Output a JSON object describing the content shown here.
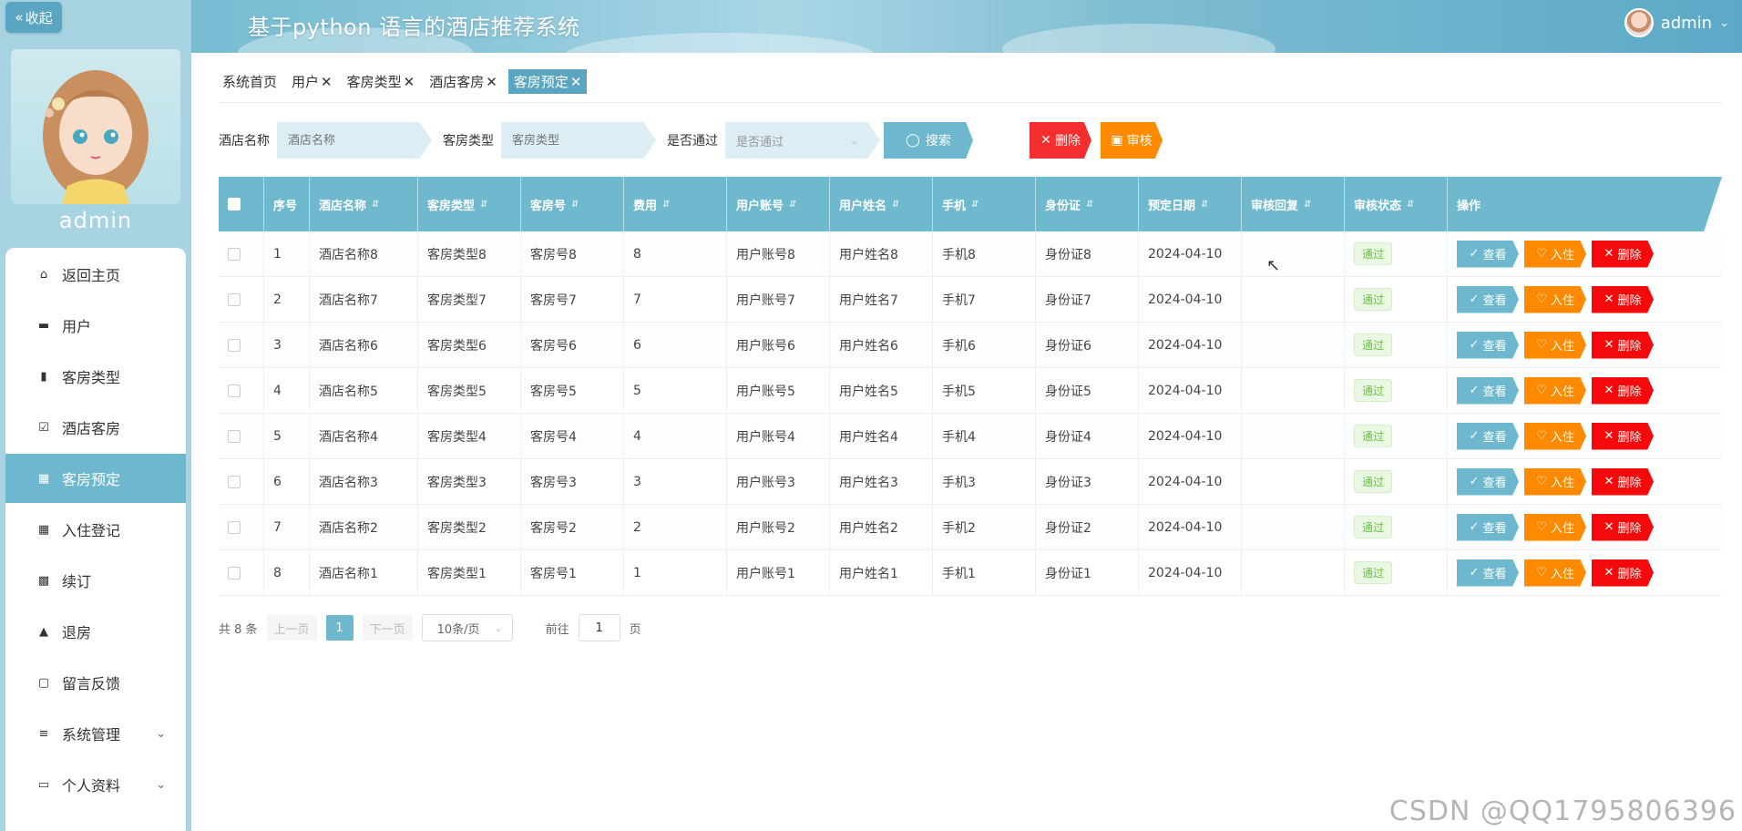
{
  "header": {
    "collapse_label": "收起",
    "app_title": "基于python 语言的酒店推荐系统",
    "username": "admin"
  },
  "sidebar": {
    "profile_name": "admin",
    "items": [
      {
        "label": "返回主页",
        "icon": "home-icon"
      },
      {
        "label": "用户",
        "icon": "monitor-icon"
      },
      {
        "label": "客房类型",
        "icon": "clipboard-icon"
      },
      {
        "label": "酒店客房",
        "icon": "clipboard-check-icon"
      },
      {
        "label": "客房预定",
        "icon": "grid-icon",
        "active": true
      },
      {
        "label": "入住登记",
        "icon": "grid-icon"
      },
      {
        "label": "续订",
        "icon": "wallet-icon"
      },
      {
        "label": "退房",
        "icon": "pin-icon"
      },
      {
        "label": "留言反馈",
        "icon": "printer-icon"
      },
      {
        "label": "系统管理",
        "icon": "sliders-icon",
        "has_children": true
      },
      {
        "label": "个人资料",
        "icon": "card-icon",
        "has_children": true
      }
    ]
  },
  "tabs": [
    {
      "label": "系统首页",
      "closable": false
    },
    {
      "label": "用户",
      "closable": true
    },
    {
      "label": "客房类型",
      "closable": true
    },
    {
      "label": "酒店客房",
      "closable": true
    },
    {
      "label": "客房预定",
      "closable": true,
      "active": true
    }
  ],
  "search": {
    "hotel_label": "酒店名称",
    "hotel_placeholder": "酒店名称",
    "room_type_label": "客房类型",
    "room_type_placeholder": "客房类型",
    "passed_label": "是否通过",
    "passed_placeholder": "是否通过",
    "search_button": "搜索",
    "delete_button": "删除",
    "audit_button": "审核"
  },
  "table": {
    "columns": [
      "序号",
      "酒店名称",
      "客房类型",
      "客房号",
      "费用",
      "用户账号",
      "用户姓名",
      "手机",
      "身份证",
      "预定日期",
      "审核回复",
      "审核状态",
      "操作"
    ],
    "rows": [
      {
        "no": "1",
        "hotel": "酒店名称8",
        "type": "客房类型8",
        "room": "客房号8",
        "fee": "8",
        "account": "用户账号8",
        "name": "用户姓名8",
        "phone": "手机8",
        "idcard": "身份证8",
        "date": "2024-04-10",
        "reply": "",
        "status": "通过"
      },
      {
        "no": "2",
        "hotel": "酒店名称7",
        "type": "客房类型7",
        "room": "客房号7",
        "fee": "7",
        "account": "用户账号7",
        "name": "用户姓名7",
        "phone": "手机7",
        "idcard": "身份证7",
        "date": "2024-04-10",
        "reply": "",
        "status": "通过"
      },
      {
        "no": "3",
        "hotel": "酒店名称6",
        "type": "客房类型6",
        "room": "客房号6",
        "fee": "6",
        "account": "用户账号6",
        "name": "用户姓名6",
        "phone": "手机6",
        "idcard": "身份证6",
        "date": "2024-04-10",
        "reply": "",
        "status": "通过"
      },
      {
        "no": "4",
        "hotel": "酒店名称5",
        "type": "客房类型5",
        "room": "客房号5",
        "fee": "5",
        "account": "用户账号5",
        "name": "用户姓名5",
        "phone": "手机5",
        "idcard": "身份证5",
        "date": "2024-04-10",
        "reply": "",
        "status": "通过"
      },
      {
        "no": "5",
        "hotel": "酒店名称4",
        "type": "客房类型4",
        "room": "客房号4",
        "fee": "4",
        "account": "用户账号4",
        "name": "用户姓名4",
        "phone": "手机4",
        "idcard": "身份证4",
        "date": "2024-04-10",
        "reply": "",
        "status": "通过"
      },
      {
        "no": "6",
        "hotel": "酒店名称3",
        "type": "客房类型3",
        "room": "客房号3",
        "fee": "3",
        "account": "用户账号3",
        "name": "用户姓名3",
        "phone": "手机3",
        "idcard": "身份证3",
        "date": "2024-04-10",
        "reply": "",
        "status": "通过"
      },
      {
        "no": "7",
        "hotel": "酒店名称2",
        "type": "客房类型2",
        "room": "客房号2",
        "fee": "2",
        "account": "用户账号2",
        "name": "用户姓名2",
        "phone": "手机2",
        "idcard": "身份证2",
        "date": "2024-04-10",
        "reply": "",
        "status": "通过"
      },
      {
        "no": "8",
        "hotel": "酒店名称1",
        "type": "客房类型1",
        "room": "客房号1",
        "fee": "1",
        "account": "用户账号1",
        "name": "用户姓名1",
        "phone": "手机1",
        "idcard": "身份证1",
        "date": "2024-04-10",
        "reply": "",
        "status": "通过"
      }
    ],
    "actions": {
      "view": "查看",
      "checkin": "入住",
      "delete": "删除"
    }
  },
  "pagination": {
    "total_text": "共 8 条",
    "prev": "上一页",
    "current": "1",
    "next": "下一页",
    "page_size": "10条/页",
    "goto_label": "前往",
    "goto_value": "1",
    "page_suffix": "页"
  },
  "watermark": "CSDN @QQ1795806396",
  "colors": {
    "accent": "#6db8cf",
    "danger": "#f40a0a",
    "warning": "#ff8a00",
    "success": "#67c23a"
  }
}
